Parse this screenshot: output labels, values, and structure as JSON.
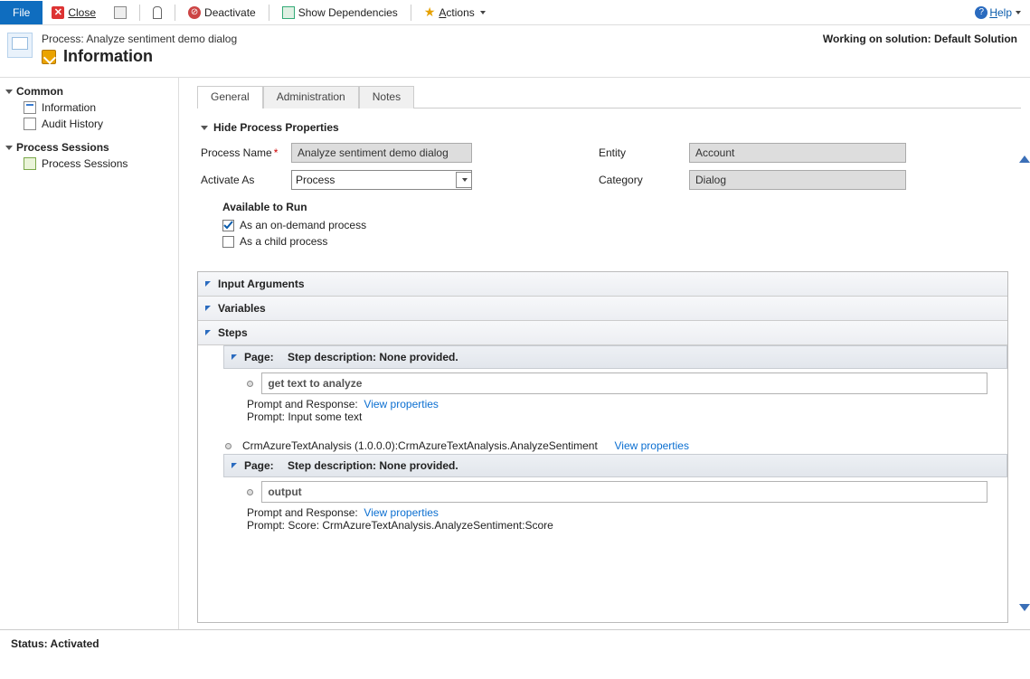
{
  "toolbar": {
    "file": "File",
    "close": "Close",
    "deactivate": "Deactivate",
    "showDeps": "Show Dependencies",
    "actions": "Actions",
    "help": "Help"
  },
  "header": {
    "breadcrumb": "Process: Analyze sentiment demo dialog",
    "title": "Information",
    "solution": "Working on solution: Default Solution"
  },
  "sidebar": {
    "groups": [
      {
        "label": "Common",
        "items": [
          "Information",
          "Audit History"
        ]
      },
      {
        "label": "Process Sessions",
        "items": [
          "Process Sessions"
        ]
      }
    ]
  },
  "tabs": [
    "General",
    "Administration",
    "Notes"
  ],
  "properties": {
    "toggle": "Hide Process Properties",
    "processName_label": "Process Name",
    "processName_value": "Analyze sentiment demo dialog",
    "activateAs_label": "Activate As",
    "activateAs_value": "Process",
    "entity_label": "Entity",
    "entity_value": "Account",
    "category_label": "Category",
    "category_value": "Dialog",
    "availableToRun": "Available to Run",
    "onDemand": "As an on-demand process",
    "asChild": "As a child process"
  },
  "grid": {
    "inputArgs": "Input Arguments",
    "variables": "Variables",
    "steps": "Steps",
    "page1": {
      "prefix": "Page:",
      "desc": "Step description: None provided.",
      "step_title": "get text to analyze",
      "prompt_label": "Prompt and Response:",
      "view": "View properties",
      "prompt_line": "Prompt:  Input some text"
    },
    "action": {
      "text": "CrmAzureTextAnalysis (1.0.0.0):CrmAzureTextAnalysis.AnalyzeSentiment",
      "view": "View properties"
    },
    "page2": {
      "prefix": "Page:",
      "desc": "Step description: None provided.",
      "step_title": "output",
      "prompt_label": "Prompt and Response:",
      "view": "View properties",
      "prompt_line": "Prompt:  Score: CrmAzureTextAnalysis.AnalyzeSentiment:Score"
    }
  },
  "status": "Status: Activated"
}
